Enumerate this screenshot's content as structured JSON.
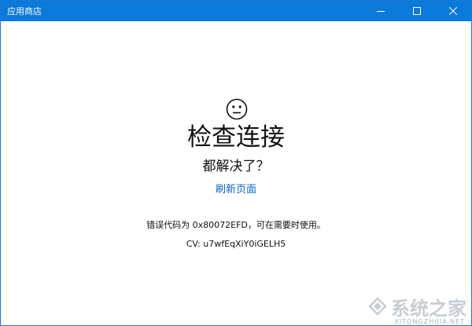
{
  "window": {
    "title": "应用商店"
  },
  "titlebar_icons": {
    "minimize": "minimize-icon",
    "maximize": "maximize-icon",
    "close": "close-icon"
  },
  "main": {
    "face_icon": "neutral-face-icon",
    "heading": "检查连接",
    "subheading": "都解决了？",
    "refresh_link": "刷新页面",
    "error_text": "错误代码为 0x80072EFD，可在需要时使用。",
    "cv_text": "CV: u7wfEqXiY0iGELH5"
  },
  "watermark": {
    "icon": "system-logo-icon",
    "text": "系统之家",
    "url": "XITONGZHIJIA.NET"
  },
  "colors": {
    "titlebar": "#0a79d9",
    "link": "#0a64c2",
    "text": "#111111"
  }
}
